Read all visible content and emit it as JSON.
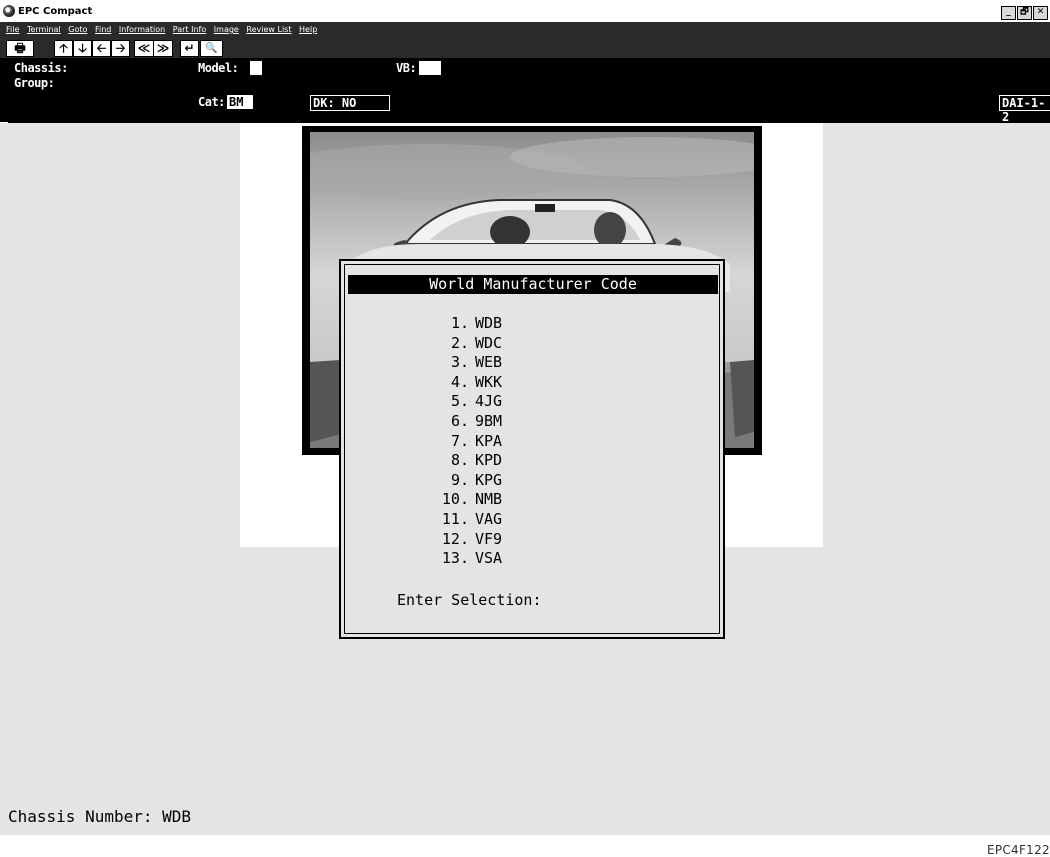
{
  "window": {
    "title": "EPC Compact",
    "controls": [
      "_",
      "🗗",
      "✕"
    ]
  },
  "menu": [
    "File",
    "Terminal",
    "Goto",
    "Find",
    "Information",
    "Part Info",
    "Image",
    "Review List",
    "Help"
  ],
  "toolbar": {
    "print": "🖶",
    "up": "🡡",
    "down": "🡣",
    "left": "🡠",
    "right": "🡢",
    "page_back": "≪",
    "page_fwd": "≫",
    "enter": "↵",
    "search": "🔍"
  },
  "info": {
    "chassis_label": "Chassis:",
    "group_label": "Group:",
    "model_label": "Model:",
    "vb_label": "VB:",
    "cat_label": "Cat:",
    "cat_value": "BM",
    "dk_label": "DK: NO",
    "dai_label": "DAI-1-2"
  },
  "dialog": {
    "title": "World Manufacturer Code",
    "items": [
      {
        "num": "1.",
        "code": "WDB"
      },
      {
        "num": "2.",
        "code": "WDC"
      },
      {
        "num": "3.",
        "code": "WEB"
      },
      {
        "num": "4.",
        "code": "WKK"
      },
      {
        "num": "5.",
        "code": "4JG"
      },
      {
        "num": "6.",
        "code": "9BM"
      },
      {
        "num": "7.",
        "code": "KPA"
      },
      {
        "num": "8.",
        "code": "KPD"
      },
      {
        "num": "9.",
        "code": "KPG"
      },
      {
        "num": "10.",
        "code": "NMB"
      },
      {
        "num": "11.",
        "code": "VAG"
      },
      {
        "num": "12.",
        "code": "VF9"
      },
      {
        "num": "13.",
        "code": "VSA"
      }
    ],
    "prompt": "Enter Selection:"
  },
  "status": {
    "chassis_number": "Chassis Number: WDB"
  },
  "footer": {
    "code": "EPC4F122"
  }
}
